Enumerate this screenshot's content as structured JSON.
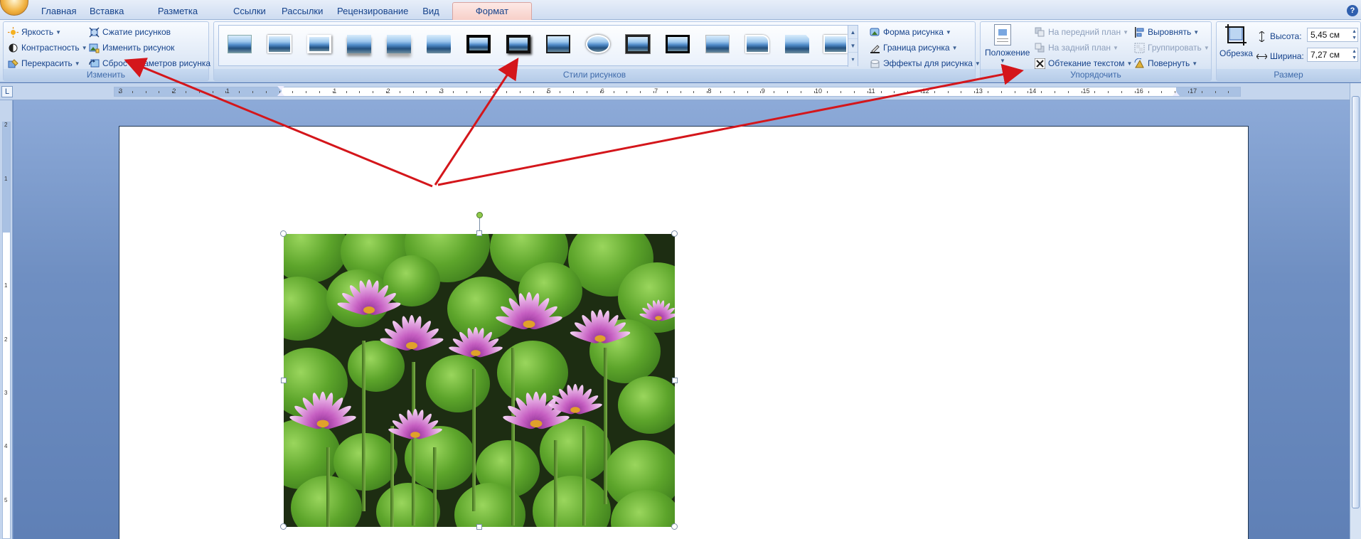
{
  "tabs": [
    "Главная",
    "Вставка",
    "Разметка страницы",
    "Ссылки",
    "Рассылки",
    "Рецензирование",
    "Вид",
    "Формат"
  ],
  "active_tab": "Формат",
  "groups": {
    "adjust": {
      "label": "Изменить",
      "brightness": "Яркость",
      "contrast": "Контрастность",
      "recolor": "Перекрасить",
      "compress": "Сжатие рисунков",
      "change": "Изменить рисунок",
      "reset": "Сброс параметров рисунка"
    },
    "styles": {
      "label": "Стили рисунков",
      "shape": "Форма рисунка",
      "border": "Граница рисунка",
      "effects": "Эффекты для рисунка"
    },
    "arrange": {
      "label": "Упорядочить",
      "position": "Положение",
      "bring_front": "На передний план",
      "send_back": "На задний план",
      "wrap": "Обтекание текстом",
      "align": "Выровнять",
      "group": "Группировать",
      "rotate": "Повернуть"
    },
    "size": {
      "label": "Размер",
      "crop": "Обрезка",
      "height_label": "Высота:",
      "height_value": "5,45 см",
      "width_label": "Ширина:",
      "width_value": "7,27 см"
    }
  },
  "ruler": {
    "numbers": [
      "3",
      "2",
      "1",
      "1",
      "2",
      "3",
      "4",
      "5",
      "6",
      "7",
      "8",
      "9",
      "10",
      "11",
      "12",
      "13",
      "14",
      "15",
      "16",
      "17"
    ],
    "corner": "L"
  },
  "vruler": {
    "numbers": [
      "2",
      "1",
      "1",
      "2",
      "3",
      "4",
      "5"
    ]
  },
  "help": "?"
}
